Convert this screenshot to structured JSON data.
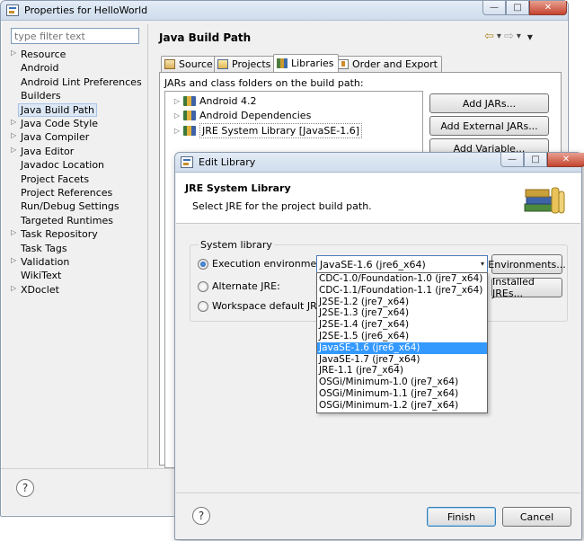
{
  "main_window": {
    "title": "Properties for HelloWorld",
    "filter_placeholder": "type filter text",
    "nav_items": [
      {
        "label": "Resource",
        "expandable": true
      },
      {
        "label": "Android",
        "expandable": false
      },
      {
        "label": "Android Lint Preferences",
        "expandable": false
      },
      {
        "label": "Builders",
        "expandable": false
      },
      {
        "label": "Java Build Path",
        "expandable": false,
        "selected": true
      },
      {
        "label": "Java Code Style",
        "expandable": true
      },
      {
        "label": "Java Compiler",
        "expandable": true
      },
      {
        "label": "Java Editor",
        "expandable": true
      },
      {
        "label": "Javadoc Location",
        "expandable": false
      },
      {
        "label": "Project Facets",
        "expandable": false
      },
      {
        "label": "Project References",
        "expandable": false
      },
      {
        "label": "Run/Debug Settings",
        "expandable": false
      },
      {
        "label": "Targeted Runtimes",
        "expandable": false
      },
      {
        "label": "Task Repository",
        "expandable": true
      },
      {
        "label": "Task Tags",
        "expandable": false
      },
      {
        "label": "Validation",
        "expandable": true
      },
      {
        "label": "WikiText",
        "expandable": false
      },
      {
        "label": "XDoclet",
        "expandable": true
      }
    ],
    "page_title": "Java Build Path",
    "tabs": [
      {
        "label": "Source",
        "active": false
      },
      {
        "label": "Projects",
        "active": false
      },
      {
        "label": "Libraries",
        "active": true
      },
      {
        "label": "Order and Export",
        "active": false
      }
    ],
    "libraries_caption": "JARs and class folders on the build path:",
    "libraries": [
      {
        "label": "Android 4.2"
      },
      {
        "label": "Android Dependencies"
      },
      {
        "label": "JRE System Library [JavaSE-1.6]"
      }
    ],
    "buttons": {
      "add_jars": "Add JARs...",
      "add_external_jars": "Add External JARs...",
      "add_variable": "Add Variable..."
    },
    "help_icon": "?"
  },
  "edit_dialog": {
    "title": "Edit Library",
    "heading": "JRE System Library",
    "description": "Select JRE for the project build path.",
    "group_label": "System library",
    "execution_env_label": "Execution environment:",
    "execution_env_value": "JavaSE-1.6 (jre6_x64)",
    "alternate_jre_label": "Alternate JRE:",
    "workspace_default_label": "Workspace default JRE (jr",
    "environments_button": "Environments...",
    "installed_jres_button": "Installed JREs...",
    "dropdown_options": [
      "CDC-1.0/Foundation-1.0 (jre7_x64)",
      "CDC-1.1/Foundation-1.1 (jre7_x64)",
      "J2SE-1.2 (jre7_x64)",
      "J2SE-1.3 (jre7_x64)",
      "J2SE-1.4 (jre7_x64)",
      "J2SE-1.5 (jre6_x64)",
      "JavaSE-1.6 (jre6_x64)",
      "JavaSE-1.7 (jre7_x64)",
      "JRE-1.1 (jre7_x64)",
      "OSGi/Minimum-1.0 (jre7_x64)",
      "OSGi/Minimum-1.1 (jre7_x64)",
      "OSGi/Minimum-1.2 (jre7_x64)"
    ],
    "selected_option_index": 6,
    "finish_button": "Finish",
    "cancel_button": "Cancel",
    "help_icon": "?"
  },
  "window_controls": {
    "minimize": "—",
    "maximize": "□",
    "close": "✕"
  },
  "nav_glyphs": {
    "back": "⇦",
    "forward": "⇨",
    "menu": "▾",
    "expand": "▷"
  }
}
